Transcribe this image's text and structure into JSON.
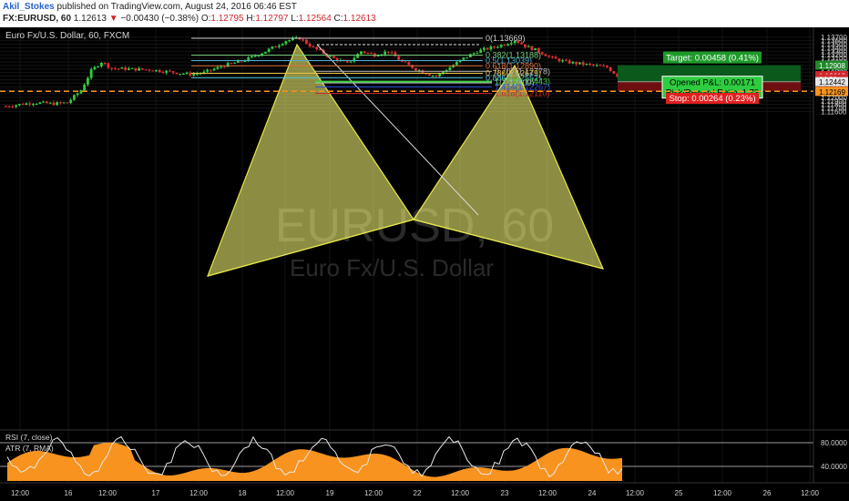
{
  "header": {
    "author": "Akil_Stokes",
    "published": "published on TradingView.com, August 24, 2016 06:46 EST",
    "symbol": "FX:EURUSD, 60",
    "last": "1.12613",
    "change": "−0.00430 (−0.38%)",
    "o_label": "O:",
    "o": "1.12795",
    "h_label": "H:",
    "h": "1.12797",
    "l_label": "L:",
    "l": "1.12564",
    "c_label": "C:",
    "c": "1.12613"
  },
  "chart": {
    "title": "Euro Fx/U.S. Dollar, 60, FXCM",
    "watermark_symbol": "EURUSD, 60",
    "watermark_name": "Euro Fx/U.S. Dollar",
    "price_axis": [
      "1.13700",
      "1.13600",
      "1.13500",
      "1.13400",
      "1.13300",
      "1.13200",
      "1.13100",
      "1.13000",
      "1.12900",
      "1.12800",
      "1.12700",
      "1.12600",
      "1.12500",
      "1.12400",
      "1.12300",
      "1.12200",
      "1.12100",
      "1.12000",
      "1.11900",
      "1.11800",
      "1.11700",
      "1.11600"
    ],
    "price_values": [
      1.137,
      1.136,
      1.135,
      1.134,
      1.133,
      1.132,
      1.131,
      1.13,
      1.129,
      1.128,
      1.127,
      1.126,
      1.125,
      1.124,
      1.123,
      1.122,
      1.121,
      1.12,
      1.119,
      1.118,
      1.117,
      1.116
    ],
    "axis_tags": [
      {
        "text": "1.12908",
        "price": 1.12908,
        "bg": "#1e8a2a",
        "fg": "#ffffff"
      },
      {
        "text": "1.12613",
        "price": 1.12613,
        "bg": "#d0262c",
        "fg": "#ffffff"
      },
      {
        "text": "14:01",
        "price": 1.12525,
        "bg": "#d0262c",
        "fg": "#ffffff"
      },
      {
        "text": "1.12442",
        "price": 1.12442,
        "bg": "#e6e6e6",
        "fg": "#000000"
      },
      {
        "text": "1.12178",
        "price": 1.12178,
        "bg": "#d0262c",
        "fg": "#ffffff"
      },
      {
        "text": "1.12169",
        "price": 1.12169,
        "bg": "#f7931e",
        "fg": "#000000"
      }
    ],
    "time_axis": [
      "12:00",
      "16",
      "12:00",
      "17",
      "12:00",
      "18",
      "12:00",
      "19",
      "12:00",
      "22",
      "12:00",
      "23",
      "12:00",
      "24",
      "12:00",
      "25",
      "12:00",
      "26",
      "12:00"
    ],
    "fib_levels": [
      {
        "text": "0(1.13669)",
        "price": 1.13669,
        "color": "#cfcfcf"
      },
      {
        "text": "0.382(1.13188)",
        "price": 1.13188,
        "color": "#7ad07a"
      },
      {
        "text": "0.5(1.13039)",
        "price": 1.13039,
        "color": "#4fb0d0"
      },
      {
        "text": "0.618(1.12890)",
        "price": 1.1289,
        "color": "#e0703a"
      },
      {
        "text": "0.707(1.12778)",
        "price": 1.12735,
        "color": "#bdbdbd"
      },
      {
        "text": "0.786(1.12679)",
        "price": 1.12679,
        "color": "#e8c040"
      },
      {
        "text": "0.886(1.12552)",
        "price": 1.12552,
        "color": "#4fc8e0"
      },
      {
        "text": "1(1.12409)",
        "price": 1.12409,
        "color": "#bdbdbd"
      },
      {
        "text": "1.272(1.12443)",
        "price": 1.12445,
        "color": "#3fcf3f"
      },
      {
        "text": "1.414(1.12267)",
        "price": 1.12295,
        "color": "#2a4fe0"
      },
      {
        "text": "1.618(1.12110)",
        "price": 1.1211,
        "color": "#d0262c"
      }
    ],
    "position": {
      "target_label": "Target: 0.00458 (0.41%)",
      "pnl_label": "Opened P&L: 0.00171",
      "rr_label": "Risk/Reward Ratio: 1.73",
      "stop_label": "Stop: 0.00264 (0.23%)",
      "target_price": 1.12908,
      "entry_price": 1.12442,
      "stop_price": 1.12178
    },
    "alert_line_price": 1.12169,
    "indicator": {
      "rsi_label": "RSI (7, close)",
      "atr_label": "ATR (7, RMA)",
      "levels": [
        "80.0000",
        "40.0000"
      ]
    },
    "colors": {
      "bg": "#000000",
      "up": "#2ecc40",
      "down": "#e03030",
      "pattern_fill": "#ffff78",
      "pattern_stroke": "#e6e64a",
      "target_zone": "#0b5a1c",
      "stop_zone": "#6e0f0f",
      "alert": "#f7931e",
      "atr_fill": "#f7931e"
    }
  }
}
